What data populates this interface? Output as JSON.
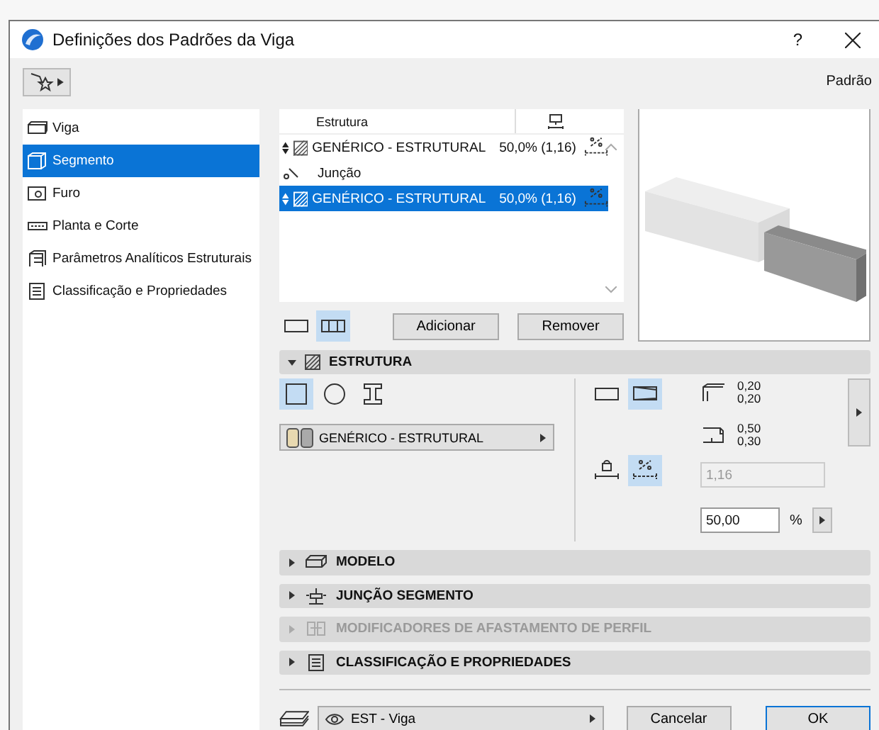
{
  "window": {
    "title": "Definições dos Padrões da Viga",
    "help": "?"
  },
  "toolbar": {
    "default_label": "Padrão"
  },
  "sidebar": {
    "items": [
      {
        "label": "Viga",
        "kind": "beam",
        "selected": false
      },
      {
        "label": "Segmento",
        "kind": "segment",
        "selected": true
      },
      {
        "label": "Furo",
        "kind": "hole",
        "selected": false
      },
      {
        "label": "Planta e Corte",
        "kind": "plan",
        "selected": false
      },
      {
        "label": "Parâmetros Analíticos Estruturais",
        "kind": "analytic",
        "selected": false
      },
      {
        "label": "Classificação e Propriedades",
        "kind": "doc",
        "selected": false
      }
    ]
  },
  "segment_table": {
    "columns": [
      "Estrutura"
    ],
    "rows": [
      {
        "kind": "segment",
        "material": "GENÉRICO - ESTRUTURAL",
        "value": "50,0% (1,16)",
        "selected": false
      },
      {
        "kind": "junction",
        "label": "Junção"
      },
      {
        "kind": "segment",
        "material": "GENÉRICO - ESTRUTURAL",
        "value": "50,0% (1,16)",
        "selected": true
      }
    ]
  },
  "view_toggles": [
    {
      "kind": "single",
      "selected": false
    },
    {
      "kind": "multi",
      "selected": true
    }
  ],
  "table_buttons": [
    "Adicionar",
    "Remover"
  ],
  "structure": {
    "title": "ESTRUTURA",
    "expanded": true,
    "shapes": [
      {
        "kind": "rect",
        "selected": true
      },
      {
        "kind": "circle",
        "selected": false
      },
      {
        "kind": "ibeam",
        "selected": false
      }
    ],
    "material": "GENÉRICO - ESTRUTURAL",
    "taper": [
      {
        "kind": "straight",
        "selected": false
      },
      {
        "kind": "tapered",
        "selected": true
      }
    ],
    "start_dims": [
      "0,20",
      "0,20"
    ],
    "end_dims": [
      "0,50",
      "0,30"
    ],
    "length_modes": [
      {
        "kind": "fixed",
        "selected": false
      },
      {
        "kind": "percent",
        "selected": true
      }
    ],
    "ratio": {
      "value": "1,16",
      "disabled": true
    },
    "percent": {
      "value": "50,00",
      "unit": "%"
    }
  },
  "sections": [
    {
      "title": "MODELO",
      "kind": "model",
      "disabled": false
    },
    {
      "title": "JUNÇÃO SEGMENTO",
      "kind": "joint",
      "disabled": false
    },
    {
      "title": "MODIFICADORES DE AFASTAMENTO DE PERFIL",
      "kind": "modifier",
      "disabled": true
    },
    {
      "title": "CLASSIFICAÇÃO E PROPRIEDADES",
      "kind": "doc",
      "disabled": false
    }
  ],
  "footer": {
    "layer": "EST - Viga",
    "buttons": [
      "Cancelar",
      "OK"
    ]
  }
}
